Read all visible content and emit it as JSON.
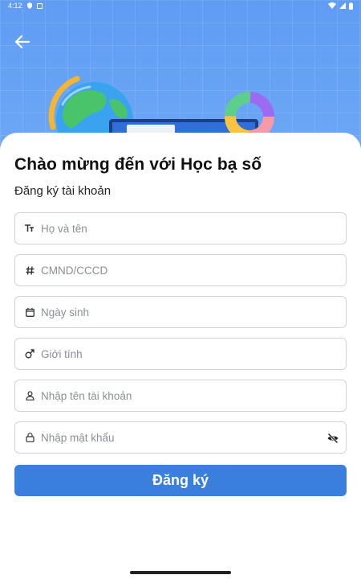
{
  "status_bar": {
    "time": "4:12",
    "icons": [
      "shield-icon",
      "notification-icon",
      "wifi-icon",
      "signal-icon",
      "battery-icon"
    ]
  },
  "header": {
    "back_icon": "arrow-left-icon"
  },
  "colors": {
    "hero_background": "#6ea8f6",
    "primary_button": "#3b7fdc",
    "field_border": "#cfd3d8"
  },
  "main": {
    "title": "Chào mừng đến với Học bạ số",
    "subtitle": "Đăng ký tài khoản"
  },
  "form": {
    "fields": [
      {
        "icon": "text-format-icon",
        "placeholder": "Họ và tên",
        "value": ""
      },
      {
        "icon": "hash-icon",
        "placeholder": "CMND/CCCD",
        "value": ""
      },
      {
        "icon": "calendar-icon",
        "placeholder": "Ngày sinh",
        "value": ""
      },
      {
        "icon": "gender-male-icon",
        "placeholder": "Giới tính",
        "value": ""
      },
      {
        "icon": "user-icon",
        "placeholder": "Nhập tên tài khoản",
        "value": ""
      },
      {
        "icon": "lock-icon",
        "placeholder": "Nhập mật khẩu",
        "value": "",
        "trailing_icon": "eye-off-icon"
      }
    ],
    "submit_label": "Đăng ký"
  }
}
